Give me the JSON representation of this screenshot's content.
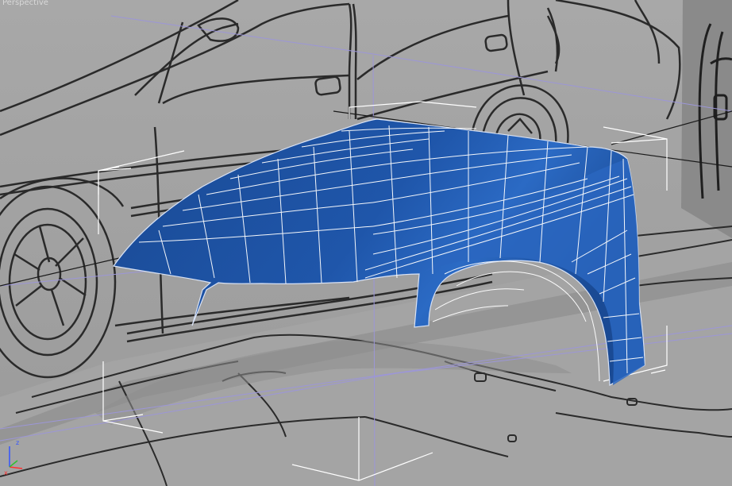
{
  "viewport": {
    "label": "Perspective",
    "mesh_color": "#1d4f9c",
    "wire_color": "#ffffff",
    "bounding_box_color": "#ffffff",
    "grid_color": "#9c96d8"
  },
  "axis_gizmo": {
    "z_label": "z",
    "x_label": "x",
    "z_color": "#3355ff",
    "x_color": "#ff3030",
    "y_color": "#30c030"
  }
}
